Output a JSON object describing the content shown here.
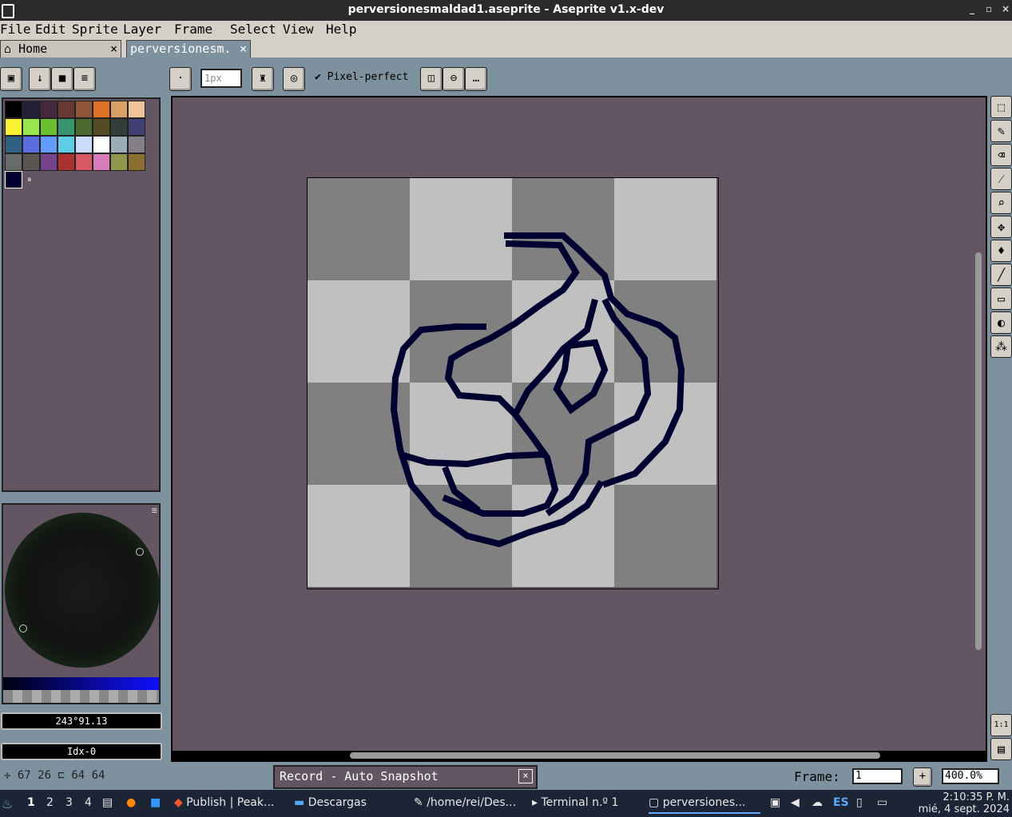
{
  "window": {
    "title": "perversionesmaldad1.aseprite - Aseprite v1.x-dev",
    "min": "_",
    "max": "▫",
    "close": "×"
  },
  "menu": [
    "File",
    "Edit",
    "Sprite",
    "Layer",
    "Frame",
    "Select",
    "View",
    "Help"
  ],
  "tabs": {
    "home": "Home",
    "file": "perversionesm.",
    "close": "×"
  },
  "toolbar": {
    "brush_size_placeholder": "1px",
    "pixel_perfect": "Pixel-perfect"
  },
  "palette": {
    "colors": [
      "#000000",
      "#222034",
      "#45283c",
      "#663931",
      "#8f563b",
      "#df7126",
      "#d9a066",
      "#eec39a",
      "#fbf236",
      "#99e550",
      "#6abe30",
      "#37946e",
      "#4b692f",
      "#524b24",
      "#323c39",
      "#3f3f74",
      "#306082",
      "#5b6ee1",
      "#639bff",
      "#5fcde4",
      "#cbdbfc",
      "#ffffff",
      "#9badb7",
      "#847e87",
      "#696a6a",
      "#595652",
      "#76428a",
      "#ac3232",
      "#d95763",
      "#d77bba",
      "#8f974a",
      "#8a6f30"
    ],
    "selected_fg": "#000000"
  },
  "color_fields": {
    "hsv": "243°91.13",
    "index": "Idx-0"
  },
  "tools": [
    "select-rect",
    "pencil",
    "eraser",
    "eyedropper",
    "zoom",
    "move",
    "fill",
    "line",
    "rectangle",
    "ellipse",
    "spray"
  ],
  "status": {
    "cursor": "67 26",
    "size": "64 64",
    "record": "Record - Auto Snapshot",
    "frame_label": "Frame:",
    "frame": "1",
    "zoom": "400.0%"
  },
  "taskbar": {
    "workspaces": [
      "1",
      "2",
      "3",
      "4"
    ],
    "items": [
      "Publish | Peak...",
      "Descargas",
      "/home/rei/Des...",
      "Terminal n.º 1",
      "perversiones..."
    ],
    "lang": "ES",
    "time": "2:10:35 P. M.",
    "date": "mié, 4 sept. 2024"
  }
}
